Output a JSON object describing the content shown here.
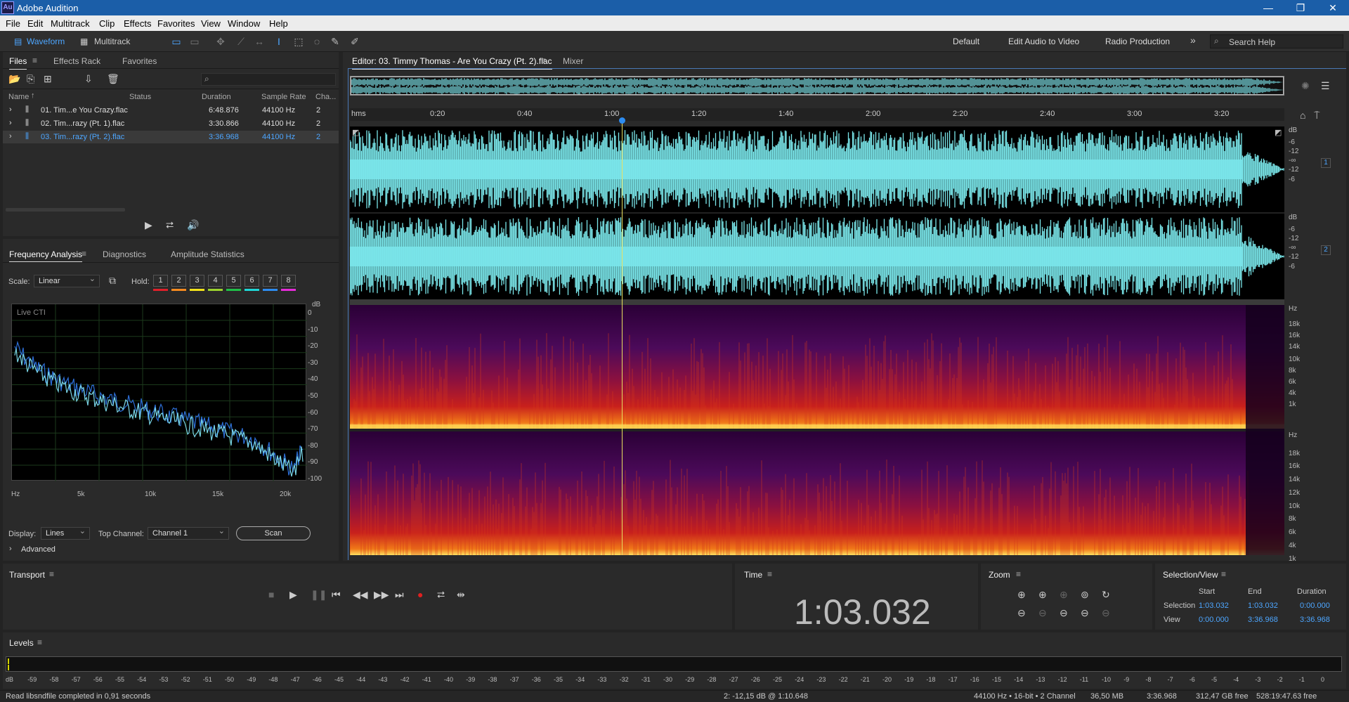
{
  "app": {
    "title": "Adobe Audition",
    "logo_text": "Au"
  },
  "menu": [
    "File",
    "Edit",
    "Multitrack",
    "Clip",
    "Effects",
    "Favorites",
    "View",
    "Window",
    "Help"
  ],
  "toolbar": {
    "waveform": "Waveform",
    "multitrack": "Multitrack",
    "workspaces": [
      "Default",
      "Edit Audio to Video",
      "Radio Production"
    ],
    "search_placeholder": "Search Help"
  },
  "files_panel": {
    "tabs": [
      "Files",
      "Effects Rack",
      "Favorites"
    ],
    "columns": [
      "Name",
      "Status",
      "Duration",
      "Sample Rate",
      "Cha..."
    ],
    "rows": [
      {
        "name": "01. Tim...e You Crazy.flac",
        "status": "",
        "duration": "6:48.876",
        "rate": "44100 Hz",
        "ch": "2"
      },
      {
        "name": "02. Tim...razy (Pt. 1).flac",
        "status": "",
        "duration": "3:30.866",
        "rate": "44100 Hz",
        "ch": "2"
      },
      {
        "name": "03. Tim...razy (Pt. 2).flac",
        "status": "",
        "duration": "3:36.968",
        "rate": "44100 Hz",
        "ch": "2"
      }
    ]
  },
  "freq_panel": {
    "tabs": [
      "Frequency Analysis",
      "Diagnostics",
      "Amplitude Statistics"
    ],
    "scale_label": "Scale:",
    "scale_value": "Linear",
    "hold_label": "Hold:",
    "hold": [
      "1",
      "2",
      "3",
      "4",
      "5",
      "6",
      "7",
      "8"
    ],
    "hold_colors": [
      "#e0202a",
      "#f58a1f",
      "#f2e21b",
      "#9bd22e",
      "#1fbf48",
      "#1fd6d6",
      "#2d8cf0",
      "#e62bd9"
    ],
    "plot_label": "Live CTI",
    "db_ticks": [
      "dB",
      "0",
      "-10",
      "-20",
      "-30",
      "-40",
      "-50",
      "-60",
      "-70",
      "-80",
      "-90",
      "-100"
    ],
    "hz_ticks": [
      "Hz",
      "5k",
      "10k",
      "15k",
      "20k"
    ],
    "display_label": "Display:",
    "display_value": "Lines",
    "top_channel_label": "Top Channel:",
    "top_channel_value": "Channel 1",
    "scan": "Scan",
    "advanced": "Advanced"
  },
  "editor": {
    "tab": "Editor: 03. Timmy Thomas - Are You Crazy (Pt. 2).flac",
    "mixer": "Mixer",
    "timeline": [
      "hms",
      "0:20",
      "0:40",
      "1:00",
      "1:20",
      "1:40",
      "2:00",
      "2:20",
      "2:40",
      "3:00",
      "3:20"
    ],
    "db_ticks": [
      "dB",
      "-6",
      "-12",
      "-∞",
      "-12",
      "-6"
    ],
    "channel_badges": [
      "1",
      "2"
    ],
    "hz_ticks_top": [
      "Hz",
      "18k",
      "16k",
      "14k",
      "10k",
      "8k",
      "6k",
      "4k",
      "1k"
    ],
    "hz_ticks_bottom": [
      "Hz",
      "18k",
      "16k",
      "14k",
      "12k",
      "10k",
      "8k",
      "6k",
      "4k",
      "1k"
    ]
  },
  "transport": {
    "title": "Transport"
  },
  "time": {
    "title": "Time",
    "value": "1:03.032"
  },
  "zoom": {
    "title": "Zoom"
  },
  "selection": {
    "title": "Selection/View",
    "cols": [
      "Start",
      "End",
      "Duration"
    ],
    "rows": [
      {
        "label": "Selection",
        "start": "1:03.032",
        "end": "1:03.032",
        "dur": "0:00.000"
      },
      {
        "label": "View",
        "start": "0:00.000",
        "end": "3:36.968",
        "dur": "3:36.968"
      }
    ]
  },
  "levels": {
    "title": "Levels",
    "ticks": [
      "dB",
      "-59",
      "-58",
      "-57",
      "-56",
      "-55",
      "-54",
      "-53",
      "-52",
      "-51",
      "-50",
      "-49",
      "-48",
      "-47",
      "-46",
      "-45",
      "-44",
      "-43",
      "-42",
      "-41",
      "-40",
      "-39",
      "-38",
      "-37",
      "-36",
      "-35",
      "-34",
      "-33",
      "-32",
      "-31",
      "-30",
      "-29",
      "-28",
      "-27",
      "-26",
      "-25",
      "-24",
      "-23",
      "-22",
      "-21",
      "-20",
      "-19",
      "-18",
      "-17",
      "-16",
      "-15",
      "-14",
      "-13",
      "-12",
      "-11",
      "-10",
      "-9",
      "-8",
      "-7",
      "-6",
      "-5",
      "-4",
      "-3",
      "-2",
      "-1",
      "0"
    ]
  },
  "status": {
    "left": "Read libsndfile completed in 0,91 seconds",
    "cursor": "2: -12,15 dB @ 1:10.648",
    "format": "44100 Hz • 16-bit • 2 Channel",
    "size": "36,50 MB",
    "dur": "3:36.968",
    "free": "312,47 GB free",
    "free_time": "528:19:47.63 free"
  }
}
